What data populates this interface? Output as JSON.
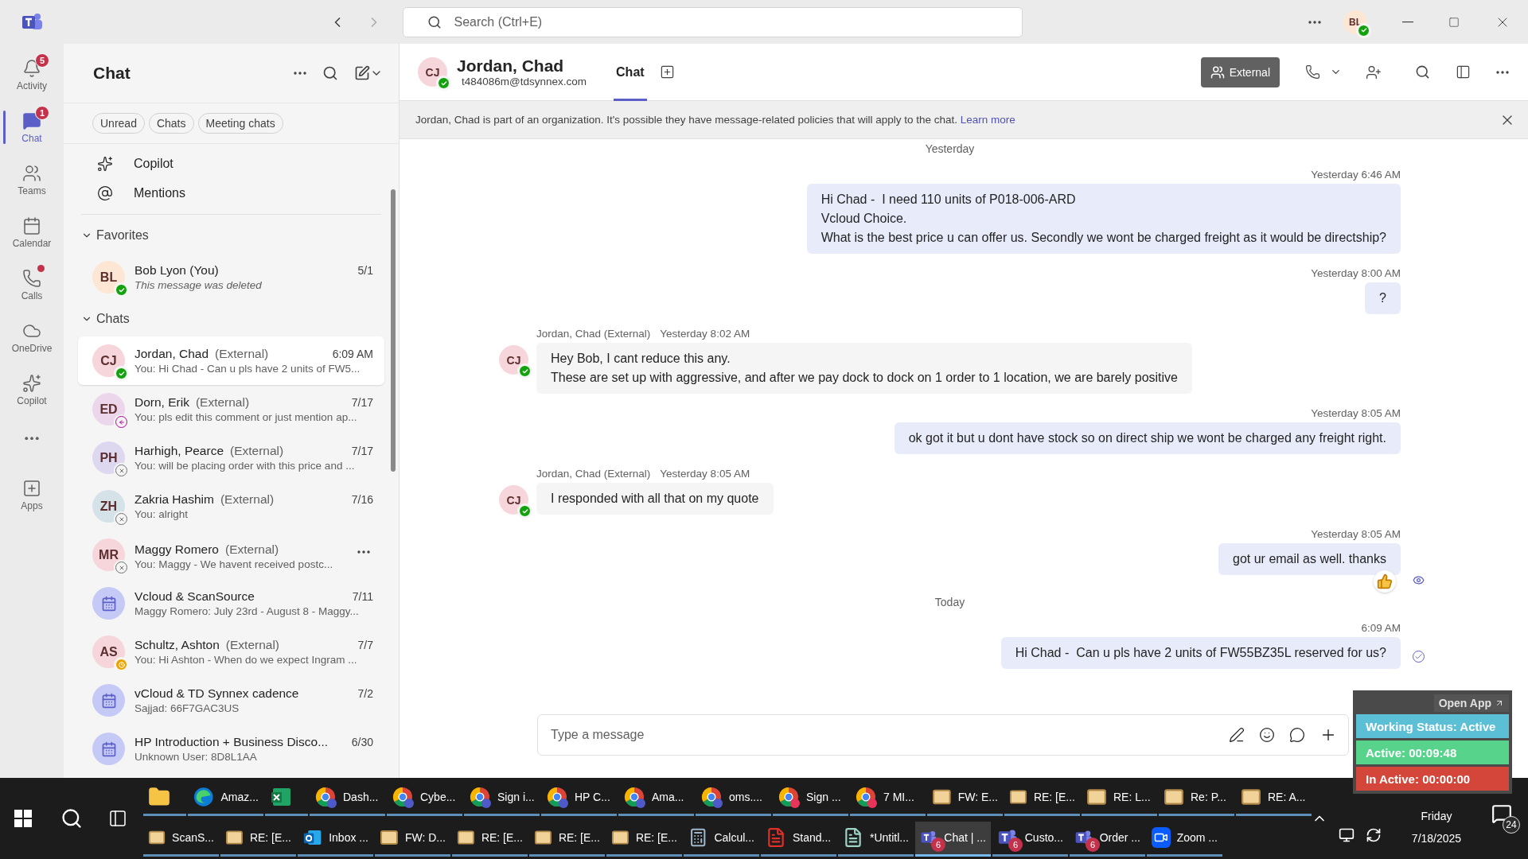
{
  "title_bar": {
    "search_placeholder": "Search (Ctrl+E)",
    "user_initials": "BL",
    "user_presence": {
      "kind": "available"
    }
  },
  "rail": [
    {
      "kind": "activity",
      "label": "Activity",
      "badge": "5",
      "dot": false,
      "selected": false
    },
    {
      "kind": "chat",
      "label": "Chat",
      "badge": "1",
      "dot": false,
      "selected": true
    },
    {
      "kind": "teams",
      "label": "Teams",
      "dot": false,
      "selected": false
    },
    {
      "kind": "calendar",
      "label": "Calendar",
      "dot": false,
      "selected": false
    },
    {
      "kind": "calls",
      "label": "Calls",
      "dot": true,
      "selected": false
    },
    {
      "kind": "onedrive",
      "label": "OneDrive",
      "dot": false,
      "selected": false
    },
    {
      "kind": "copilot",
      "label": "Copilot",
      "dot": false,
      "selected": false
    },
    {
      "kind": "more",
      "selected": false
    },
    {
      "kind": "apps",
      "label": "Apps",
      "dot": false,
      "selected": false
    }
  ],
  "chat_panel": {
    "title": "Chat",
    "filters": [
      {
        "label": "Unread",
        "selected": false
      },
      {
        "label": "Chats",
        "selected": false
      },
      {
        "label": "Meeting chats",
        "selected": false
      }
    ],
    "shortcuts": [
      {
        "kind": "copilot",
        "label": "Copilot"
      },
      {
        "kind": "mentions",
        "label": "Mentions"
      }
    ],
    "sections": [
      {
        "title": "Favorites",
        "expanded": true,
        "items": [
          {
            "kind": "person",
            "initials": "BL",
            "color": "#fde7d4",
            "name": "Bob Lyon (You)",
            "time": "5/1",
            "preview": "This message was deleted",
            "preview_italic": true,
            "presence": {
              "kind": "available"
            },
            "selected": false,
            "hovered": false
          }
        ]
      },
      {
        "title": "Chats",
        "expanded": true,
        "items": [
          {
            "kind": "person",
            "initials": "CJ",
            "color": "#f6d5db",
            "name": "Jordan, Chad",
            "tag": "(External)",
            "time": "6:09 AM",
            "preview": "You: Hi Chad -  Can u pls have 2 units of FW5...",
            "preview_italic": false,
            "presence": {
              "kind": "available"
            },
            "selected": true,
            "hovered": false
          },
          {
            "kind": "person",
            "initials": "ED",
            "color": "#ecd6ec",
            "name": "Dorn, Erik",
            "tag": "(External)",
            "time": "7/17",
            "preview": "You: pls edit this comment or just mention ap...",
            "preview_italic": false,
            "presence": {
              "kind": "absent"
            },
            "selected": false,
            "hovered": false
          },
          {
            "kind": "person",
            "initials": "PH",
            "color": "#ddd8ef",
            "name": "Harhigh, Pearce",
            "tag": "(External)",
            "time": "7/17",
            "preview": "You: will be placing order with this price and ...",
            "preview_italic": false,
            "presence": {
              "kind": "offline"
            },
            "selected": false,
            "hovered": false
          },
          {
            "kind": "person",
            "initials": "ZH",
            "color": "#d5e3e8",
            "name": "Zakria Hashim",
            "tag": "(External)",
            "time": "7/16",
            "preview": "You: alright",
            "preview_italic": false,
            "presence": {
              "kind": "offline"
            },
            "selected": false,
            "hovered": false
          },
          {
            "kind": "person",
            "initials": "MR",
            "color": "#f6d5db",
            "name": "Maggy Romero",
            "tag": "(External)",
            "preview": "You: Maggy - We havent received postc...",
            "preview_italic": false,
            "presence": {
              "kind": "offline"
            },
            "selected": false,
            "hovered": true
          },
          {
            "kind": "meeting",
            "name": "Vcloud & ScanSource",
            "time": "7/11",
            "preview": "Maggy Romero: July 23rd - August 8 - Maggy...",
            "preview_italic": false,
            "selected": false,
            "hovered": false
          },
          {
            "kind": "person",
            "initials": "AS",
            "color": "#f6d5db",
            "name": "Schultz, Ashton",
            "tag": "(External)",
            "time": "7/7",
            "preview": "You: Hi Ashton -  When do we expect Ingram ...",
            "preview_italic": false,
            "presence": {
              "kind": "away"
            },
            "selected": false,
            "hovered": false
          },
          {
            "kind": "meeting",
            "name": "vCloud & TD Synnex cadence",
            "time": "7/2",
            "preview": "Sajjad: 66F7GAC3US",
            "preview_italic": false,
            "selected": false,
            "hovered": false
          },
          {
            "kind": "meeting",
            "name": "HP Introduction + Business Disco...",
            "time": "6/30",
            "preview": "Unknown User: 8D8L1AA",
            "preview_italic": false,
            "selected": false,
            "hovered": false
          }
        ]
      }
    ]
  },
  "conversation": {
    "initials": "CJ",
    "name": "Jordan, Chad",
    "email": "t484086m@tdsynnex.com",
    "presence": {
      "kind": "available"
    },
    "tabs": [
      {
        "label": "Chat",
        "selected": true
      }
    ],
    "external_label": "External",
    "banner": {
      "text": "Jordan, Chad is part of an organization. It's possible they have message-related policies that will apply to the chat.",
      "link": "Learn more"
    },
    "messages": [
      {
        "kind": "divider",
        "label": "Yesterday"
      },
      {
        "kind": "outgoing",
        "time": "Yesterday 6:46 AM",
        "lines": [
          "Hi Chad -  I need 110 units of P018-006-ARD",
          "Vcloud Choice.",
          "What is the best price u can offer us. Secondly we wont be charged freight as it would be directship?"
        ]
      },
      {
        "kind": "outgoing",
        "time": "Yesterday 8:00 AM",
        "lines": [
          "?"
        ]
      },
      {
        "kind": "incoming",
        "sender": "Jordan, Chad (External)",
        "time": "Yesterday 8:02 AM",
        "initials": "CJ",
        "presence": {
          "kind": "available"
        },
        "lines": [
          "Hey Bob, I cant reduce this any.",
          "These are set up with aggressive, and after we pay dock to dock on 1 order to 1 location, we are barely positive"
        ]
      },
      {
        "kind": "outgoing",
        "time": "Yesterday 8:05 AM",
        "lines": [
          "ok got it but u dont have stock so on direct ship we wont be charged any freight right."
        ]
      },
      {
        "kind": "incoming",
        "sender": "Jordan, Chad (External)",
        "time": "Yesterday 8:05 AM",
        "initials": "CJ",
        "presence": {
          "kind": "available"
        },
        "lines": [
          "I responded with all that on my quote"
        ]
      },
      {
        "kind": "outgoing",
        "time": "Yesterday 8:05 AM",
        "lines": [
          "got ur email as well. thanks"
        ],
        "receipt": {
          "kind": "seen"
        },
        "reacted": true
      },
      {
        "kind": "divider",
        "label": "Today"
      },
      {
        "kind": "outgoing",
        "time": "6:09 AM",
        "lines": [
          "Hi Chad -  Can u pls have 2 units of FW55BZ35L reserved for us?"
        ],
        "receipt": {
          "kind": "sent"
        },
        "reacted": false
      }
    ],
    "composer": {
      "placeholder": "Type a message"
    }
  },
  "widget": {
    "button": "Open App",
    "rows": [
      {
        "label": "Working Status: Active",
        "color": "#5bbfd6"
      },
      {
        "label": "Active: 00:09:48",
        "color": "#58d38c"
      },
      {
        "label": "In Active: 00:00:00",
        "color": "#d4463a"
      }
    ]
  },
  "taskbar": {
    "rows": [
      {
        "items": [
          {
            "kind": "explorer",
            "selected": false
          },
          {
            "kind": "edge",
            "label": "Amaz...",
            "selected": false
          },
          {
            "kind": "excel",
            "selected": false
          },
          {
            "kind": "chrome",
            "label": "Dash...",
            "selected": false
          },
          {
            "kind": "chrome",
            "label": "Cybe...",
            "selected": false
          },
          {
            "kind": "chrome",
            "label": "Sign i...",
            "selected": false
          },
          {
            "kind": "chrome",
            "label": "HP C...",
            "selected": false
          },
          {
            "kind": "chrome",
            "label": "Ama...",
            "selected": false
          },
          {
            "kind": "chrome",
            "label": "oms....",
            "selected": false
          },
          {
            "kind": "chromered",
            "label": "Sign ...",
            "selected": false
          },
          {
            "kind": "chromered",
            "label": "7 MI...",
            "selected": false
          },
          {
            "kind": "mail",
            "label": "FW: E...",
            "selected": false
          },
          {
            "kind": "mail",
            "label": "RE: [E...",
            "selected": false
          },
          {
            "kind": "mail",
            "label": "RE: L...",
            "selected": false
          },
          {
            "kind": "mail",
            "label": "Re: P...",
            "selected": false
          },
          {
            "kind": "mail",
            "label": "RE: A...",
            "selected": false
          }
        ]
      },
      {
        "items": [
          {
            "kind": "mail",
            "label": "ScanS...",
            "selected": false
          },
          {
            "kind": "mail",
            "label": "RE: [E...",
            "selected": false
          },
          {
            "kind": "outlook",
            "label": "Inbox ...",
            "selected": false
          },
          {
            "kind": "mail",
            "label": "FW: D...",
            "selected": false
          },
          {
            "kind": "mail",
            "label": "RE: [E...",
            "selected": false
          },
          {
            "kind": "mail",
            "label": "RE: [E...",
            "selected": false
          },
          {
            "kind": "mail",
            "label": "RE: [E...",
            "selected": false
          },
          {
            "kind": "calculator",
            "label": "Calcul...",
            "selected": false
          },
          {
            "kind": "pdf",
            "label": "Stand...",
            "selected": false
          },
          {
            "kind": "notepad",
            "label": "*Untitl...",
            "selected": false
          },
          {
            "kind": "teams",
            "label": "Chat | ...",
            "badge": "6",
            "selected": true
          },
          {
            "kind": "teams",
            "label": "Custo...",
            "badge": "6",
            "selected": false
          },
          {
            "kind": "teams",
            "label": "Order ...",
            "badge": "6",
            "selected": false
          },
          {
            "kind": "zoom",
            "label": "Zoom ...",
            "selected": false
          }
        ]
      }
    ],
    "tray": {
      "day": "Friday",
      "date": "7/18/2025",
      "notifications": "24"
    }
  }
}
